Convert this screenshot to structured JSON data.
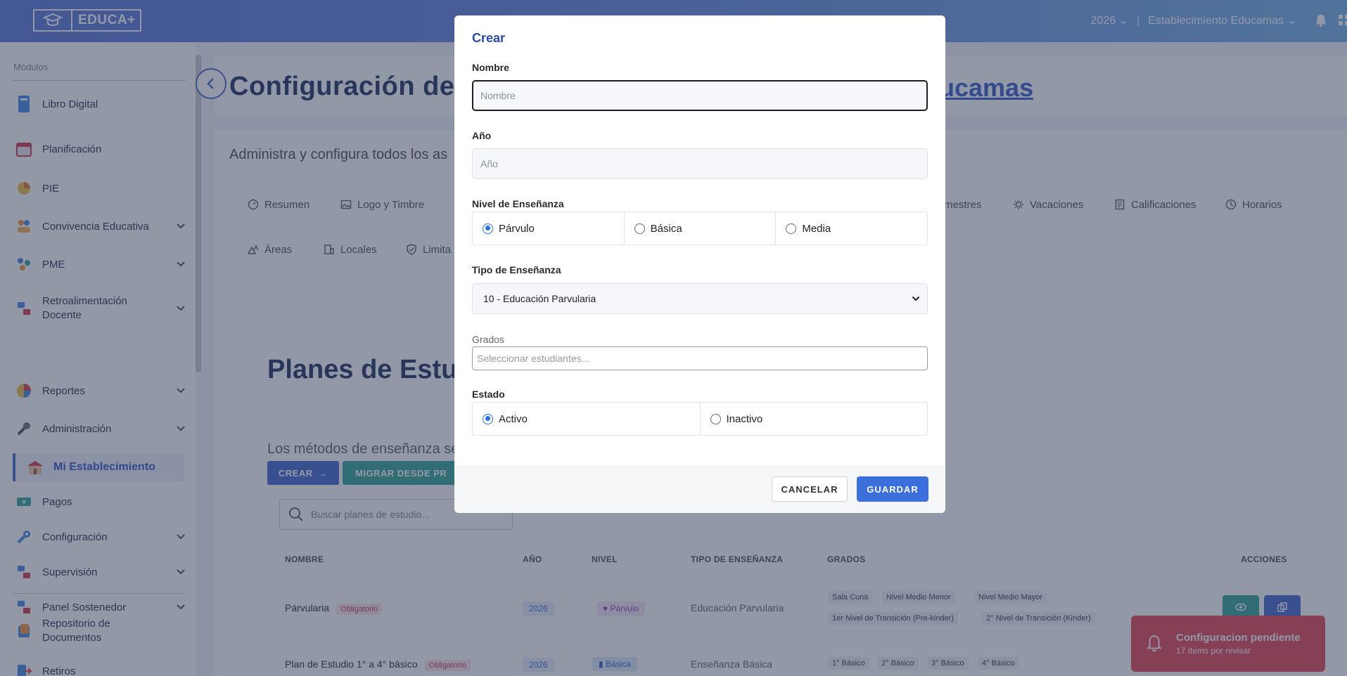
{
  "topbar": {
    "logo_text": "EDUCA+",
    "year": "2026",
    "separator": "|",
    "establishment": "Establecimiento Educamas"
  },
  "sidebar": {
    "section_label": "Módulos",
    "items": [
      {
        "label": "Libro Digital",
        "icon": "book-icon"
      },
      {
        "label": "Planificación",
        "icon": "calendar-icon"
      },
      {
        "label": "PIE",
        "icon": "pie-icon"
      },
      {
        "label": "Convivencia Educativa",
        "icon": "people-icon"
      },
      {
        "label": "PME",
        "icon": "chart-icon"
      },
      {
        "label": "Retroalimentación Docente",
        "icon": "feedback-icon"
      },
      {
        "label": "Reportes",
        "icon": "report-icon"
      },
      {
        "label": "Administración",
        "icon": "wrench-icon"
      },
      {
        "label": "Mi Establecimiento",
        "icon": "school-icon"
      },
      {
        "label": "Pagos",
        "icon": "money-icon"
      },
      {
        "label": "Configuración",
        "icon": "settings-icon"
      },
      {
        "label": "Supervisión",
        "icon": "supervision-icon"
      },
      {
        "label": "Panel Sostenedor",
        "icon": "panel-icon"
      },
      {
        "label": "Repositorio de Documentos",
        "icon": "documents-icon"
      },
      {
        "label": "Retiros",
        "icon": "exit-icon"
      }
    ]
  },
  "main": {
    "title_left": "Configuración de",
    "title_right": "ucamas",
    "subtitle": "Administra y configura todos los as",
    "tabs_row1": [
      "Resumen",
      "Logo y Timbre",
      "mestres",
      "Vacaciones",
      "Calificaciones",
      "Horarios"
    ],
    "tabs_row2": [
      "Áreas",
      "Locales",
      "Limita"
    ],
    "planes_title": "Planes de Estu",
    "metodos_text": "Los métodos de enseñanza se",
    "btn_crear": "CREAR",
    "btn_migrar": "MIGRAR DESDE PR",
    "search_placeholder": "Buscar planes de estudio...",
    "table": {
      "headers": [
        "NOMBRE",
        "AÑO",
        "NIVEL",
        "TIPO DE ENSEÑANZA",
        "GRADOS",
        "ACCIONES"
      ],
      "rows": [
        {
          "nombre": "Párvularia",
          "badge": "Obligatorio",
          "anio": "2026",
          "nivel": "Párvulo",
          "tipo": "Educación Parvularia",
          "grados": [
            "Sala Cuna",
            "Nivel Medio Menor",
            "Nivel Medio Mayor",
            "1er Nivel de Transición (Pre-kinder)",
            "2° Nivel de Transición (Kinder)"
          ]
        },
        {
          "nombre": "Plan de Estudio 1° a 4° básico",
          "badge": "Obligatorio",
          "anio": "2026",
          "nivel": "Básica",
          "tipo": "Enseñanza Básica",
          "grados": [
            "1° Básico",
            "2° Básico",
            "3° Básico",
            "4° Básico"
          ]
        }
      ]
    }
  },
  "toast": {
    "title": "Configuracion pendiente",
    "subtitle": "17 ítems por revisar"
  },
  "modal": {
    "title": "Crear",
    "nombre_label": "Nombre",
    "nombre_placeholder": "Nombre",
    "anio_label": "Año",
    "anio_placeholder": "Año",
    "nivel_label": "Nivel de Enseñanza",
    "nivel_options": [
      "Párvulo",
      "Básica",
      "Media"
    ],
    "nivel_selected": "Párvulo",
    "tipo_label": "Tipo de Enseñanza",
    "tipo_selected": "10 - Educación Parvularia",
    "grados_label": "Grados",
    "grados_placeholder": "Seleccionar estudiantes...",
    "estado_label": "Estado",
    "estado_options": [
      "Activo",
      "Inactivo"
    ],
    "estado_selected": "Activo",
    "cancel_label": "CANCELAR",
    "save_label": "GUARDAR"
  },
  "colors": {
    "primary": "#4a6fd1",
    "teal": "#3aa99a",
    "danger": "#e54f5c",
    "save": "#3b6fdc"
  }
}
